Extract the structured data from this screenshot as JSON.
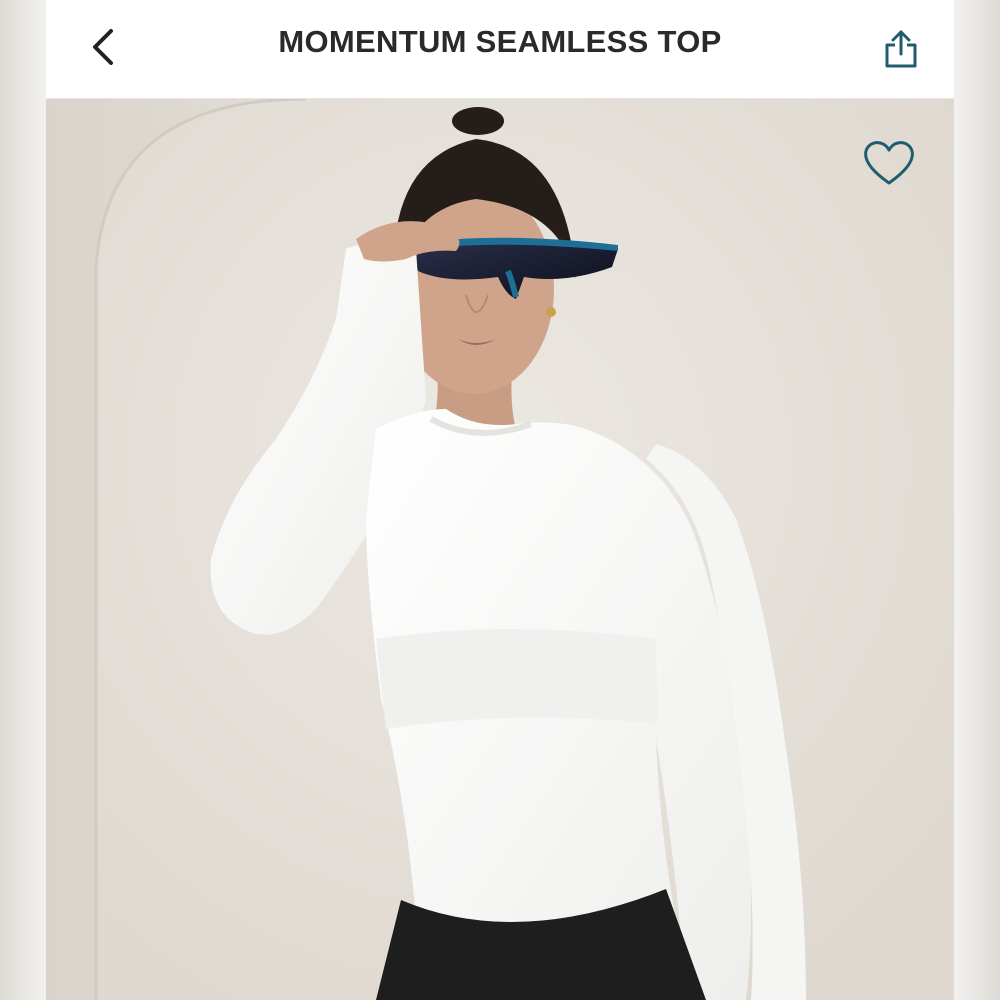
{
  "header": {
    "title": "MOMENTUM SEAMLESS TOP",
    "back_icon": "chevron-left-icon",
    "share_icon": "share-icon"
  },
  "product_image": {
    "favorite_icon": "heart-outline-icon"
  },
  "colors": {
    "accent": "#1f5d6e",
    "title_text": "#2a2a2a",
    "background": "#ffffff"
  }
}
